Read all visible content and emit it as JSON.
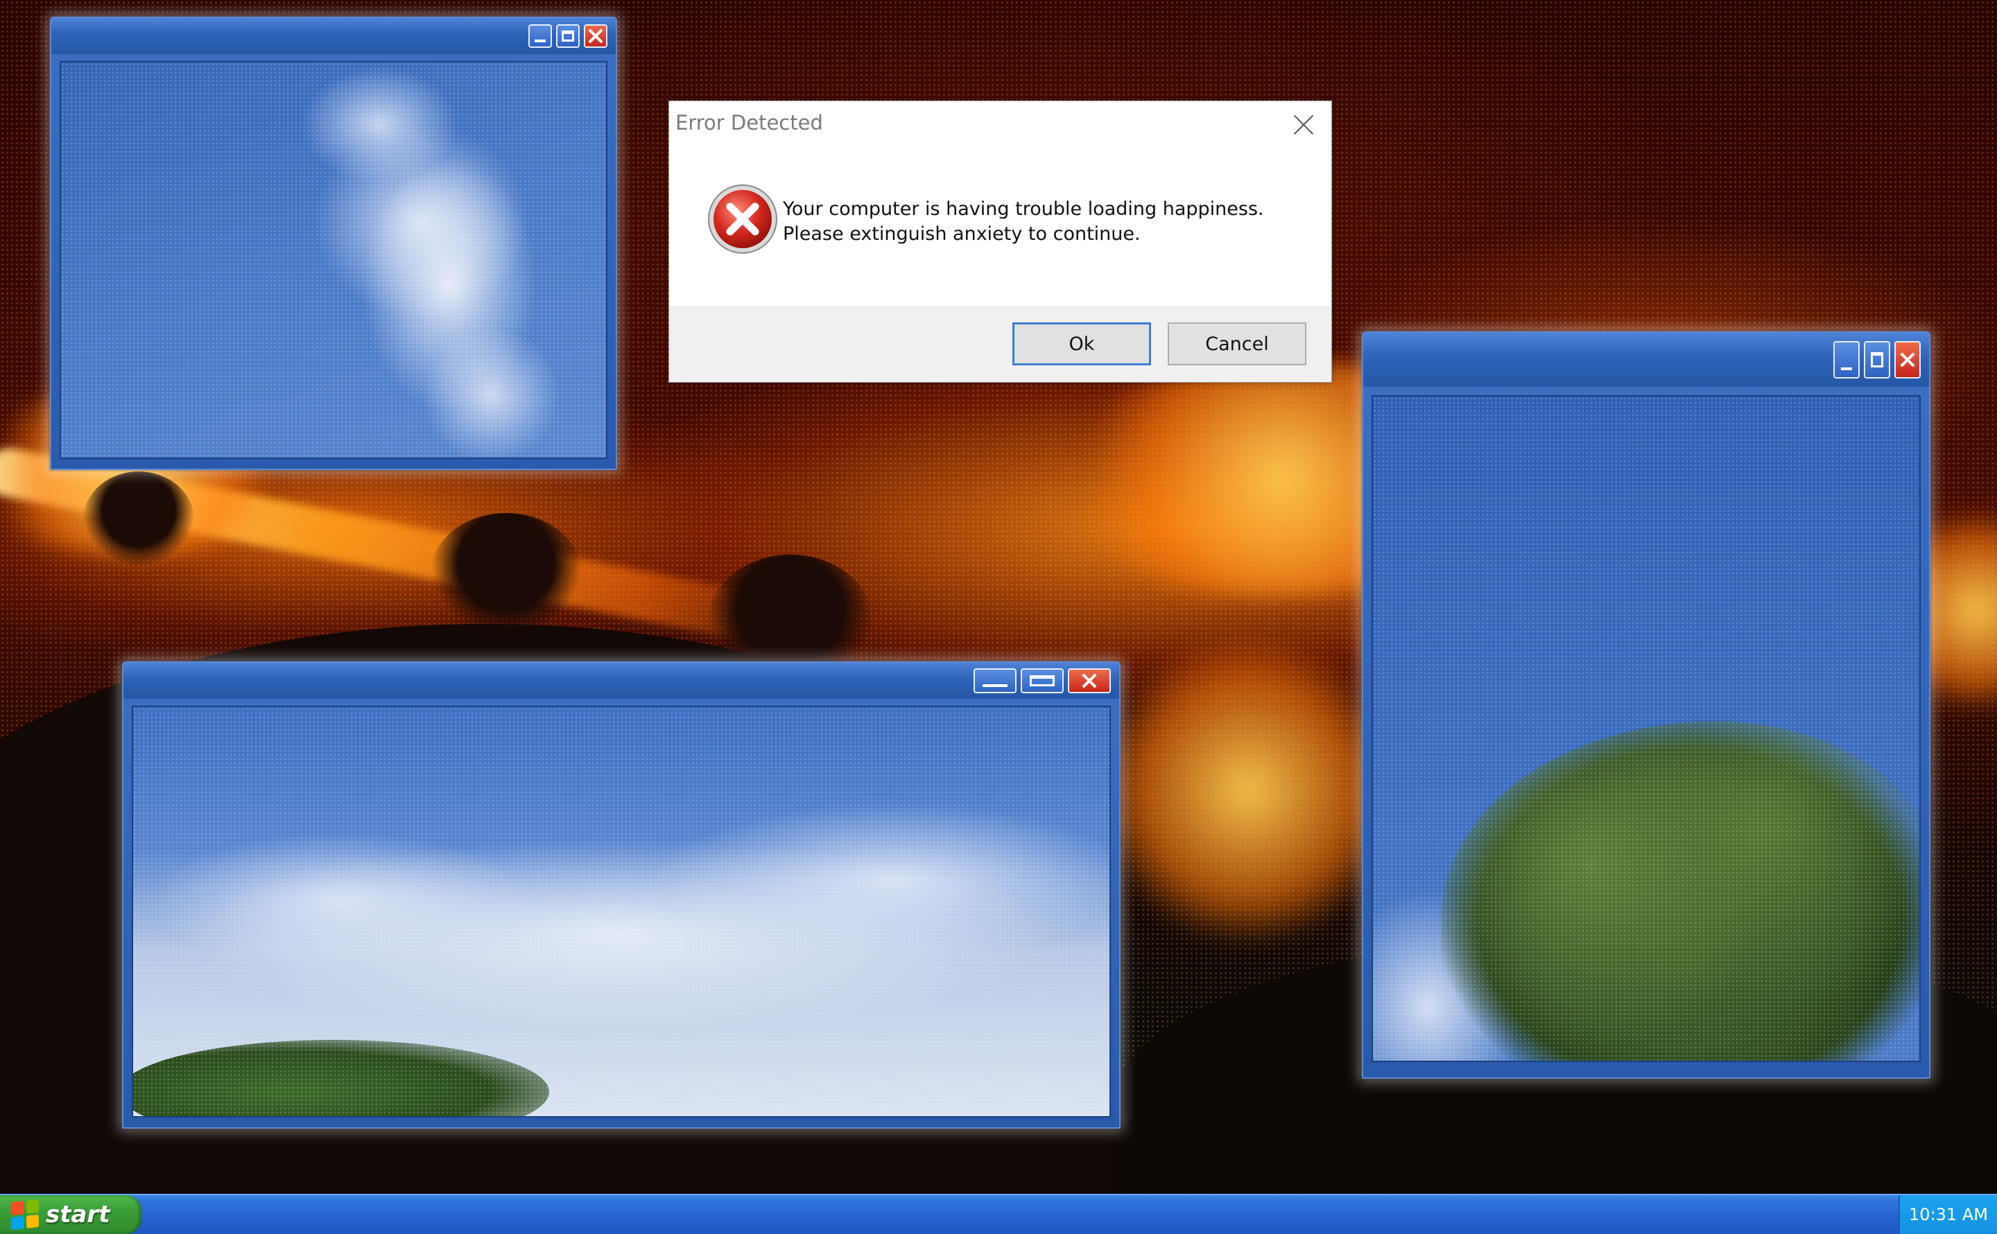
{
  "dialog": {
    "title": "Error Detected",
    "message_line1": "Your computer is having trouble loading happiness.",
    "message_line2": "Please extinguish anxiety to continue.",
    "ok_label": "Ok",
    "cancel_label": "Cancel",
    "icon": "error-icon"
  },
  "windows": [
    {
      "name": "sky-window-top-left",
      "content": "clouds-photo",
      "buttons": [
        "minimize",
        "maximize",
        "close"
      ]
    },
    {
      "name": "sky-window-bottom",
      "content": "clouds-photo",
      "buttons": [
        "minimize",
        "maximize",
        "close"
      ]
    },
    {
      "name": "sky-window-right",
      "content": "tree-photo",
      "buttons": [
        "minimize",
        "maximize",
        "close"
      ]
    }
  ],
  "taskbar": {
    "start_label": "start",
    "clock": "10:31 AM"
  },
  "colors": {
    "xp_blue": "#2a5aab",
    "start_green": "#3b9e38",
    "close_red": "#c6251a",
    "tray_blue": "#1390e0",
    "fire_orange": "#ff8c14"
  }
}
